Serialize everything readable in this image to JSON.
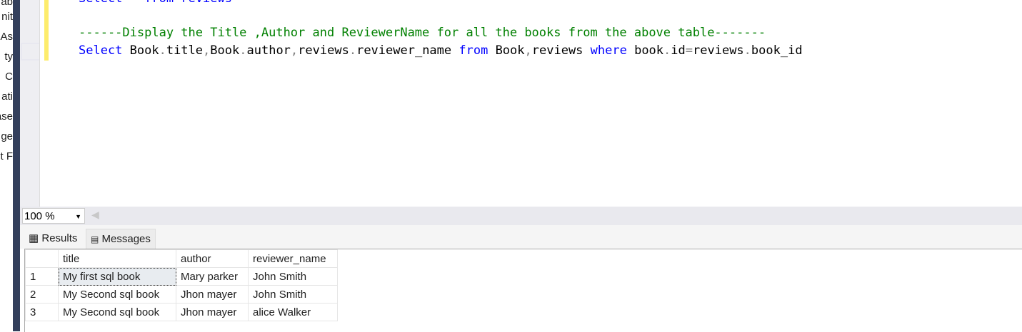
{
  "left_panel": {
    "fragments": [
      "ab",
      "nit",
      "As",
      "ty",
      "C",
      "ati",
      "ase",
      "ge",
      "t F"
    ]
  },
  "editor": {
    "line0": "Select * from reviews",
    "comment": "------Display the Title ,Author and ReviewerName for all the books from the above table-------",
    "query_tokens": [
      {
        "t": "Select",
        "c": "kw"
      },
      {
        "t": " Book",
        "c": ""
      },
      {
        "t": ".",
        "c": "op"
      },
      {
        "t": "title",
        "c": ""
      },
      {
        "t": ",",
        "c": "op"
      },
      {
        "t": "Book",
        "c": ""
      },
      {
        "t": ".",
        "c": "op"
      },
      {
        "t": "author",
        "c": ""
      },
      {
        "t": ",",
        "c": "op"
      },
      {
        "t": "reviews",
        "c": ""
      },
      {
        "t": ".",
        "c": "op"
      },
      {
        "t": "reviewer_name ",
        "c": ""
      },
      {
        "t": "from",
        "c": "kw"
      },
      {
        "t": " Book",
        "c": ""
      },
      {
        "t": ",",
        "c": "op"
      },
      {
        "t": "reviews ",
        "c": ""
      },
      {
        "t": "where",
        "c": "kw"
      },
      {
        "t": " book",
        "c": ""
      },
      {
        "t": ".",
        "c": "op"
      },
      {
        "t": "id",
        "c": ""
      },
      {
        "t": "=",
        "c": "op"
      },
      {
        "t": "reviews",
        "c": ""
      },
      {
        "t": ".",
        "c": "op"
      },
      {
        "t": "book_id",
        "c": ""
      }
    ]
  },
  "zoom": {
    "value": "100 %"
  },
  "tabs": {
    "results": "Results",
    "messages": "Messages"
  },
  "grid": {
    "columns": [
      "",
      "title",
      "author",
      "reviewer_name"
    ],
    "rows": [
      [
        "1",
        "My first sql book",
        "Mary parker",
        "John Smith"
      ],
      [
        "2",
        "My Second  sql book",
        "Jhon mayer",
        "John Smith"
      ],
      [
        "3",
        "My Second  sql book",
        "Jhon mayer",
        "alice Walker"
      ]
    ]
  }
}
